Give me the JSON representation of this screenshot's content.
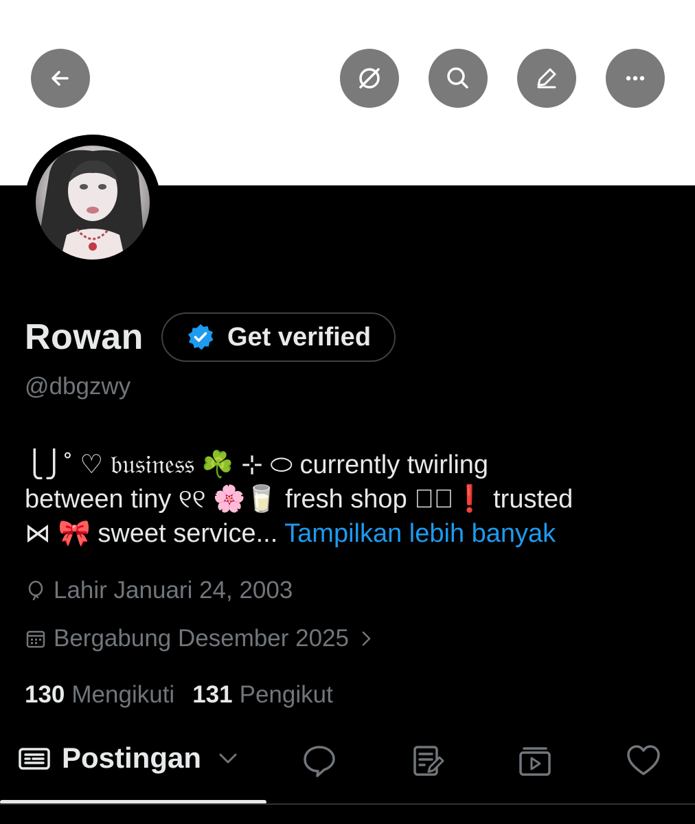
{
  "header": {
    "icons": [
      "back-arrow-icon",
      "no-grok-icon",
      "search-icon",
      "edit-icon",
      "more-icon"
    ]
  },
  "profile": {
    "name": "Rowan",
    "verify_label": "Get verified",
    "handle": "@dbgzwy",
    "bio_line1": "⎩⎭˚ ♡ 𝔟𝔲𝔰𝔦𝔫𝔢𝔰𝔰 ☘️ ⊹ ⬭ currently twirling",
    "bio_line2": "between tiny ୧୧ 🌸🥛 fresh shop ♡⃝❗ trusted",
    "bio_line3": "⋈ 🎀 sweet service...",
    "show_more": "Tampilkan lebih banyak",
    "birth": "Lahir Januari 24, 2003",
    "joined": "Bergabung Desember 2025",
    "following_count": "130",
    "following_label": "Mengikuti",
    "followers_count": "131",
    "followers_label": "Pengikut"
  },
  "tabs": {
    "active_label": "Postingan",
    "icons": [
      "posts-icon",
      "replies-icon",
      "articles-icon",
      "media-icon",
      "likes-icon"
    ]
  },
  "colors": {
    "accent": "#1d9bf0",
    "muted": "#71767b",
    "text": "#e7e9ea",
    "button_bg": "#7a7a7a"
  }
}
